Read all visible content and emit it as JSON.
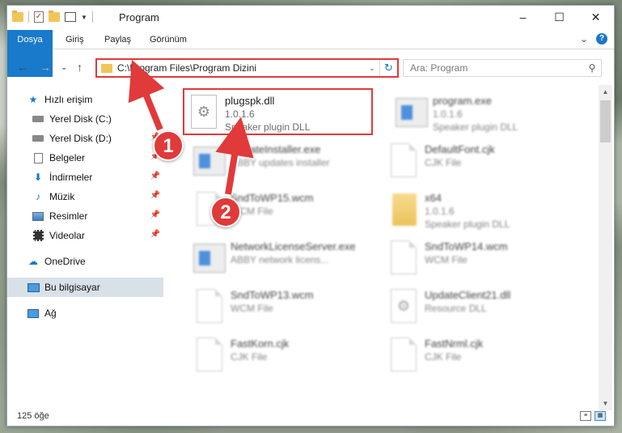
{
  "window": {
    "title": "Program",
    "controls": [
      "–",
      "☐",
      "✕"
    ]
  },
  "ribbon": {
    "tabs": [
      "Dosya",
      "Giriş",
      "Paylaş",
      "Görünüm"
    ],
    "expand": "⌄",
    "help": "?"
  },
  "navigation": {
    "back": "←",
    "forward": "→",
    "recent": "⌄",
    "up": "↑",
    "address": "C:\\Program Files\\Program Dizini",
    "address_dropdown": "⌄",
    "refresh": "↻",
    "search_placeholder": "Ara: Program",
    "search_icon_glyph": "⚲"
  },
  "sidebar": {
    "items": [
      {
        "label": "Hızlı erişim",
        "icon": "star-icon",
        "pinned": false
      },
      {
        "label": "Yerel Disk (C:)",
        "icon": "drive-icon",
        "pinned": true
      },
      {
        "label": "Yerel Disk (D:)",
        "icon": "drive-icon",
        "pinned": true
      },
      {
        "label": "Belgeler",
        "icon": "documents-icon",
        "pinned": true
      },
      {
        "label": "İndirmeler",
        "icon": "download-icon",
        "pinned": true
      },
      {
        "label": "Müzik",
        "icon": "music-icon",
        "pinned": true
      },
      {
        "label": "Resimler",
        "icon": "pictures-icon",
        "pinned": true
      },
      {
        "label": "Videolar",
        "icon": "videos-icon",
        "pinned": true
      },
      {
        "label": "OneDrive",
        "icon": "cloud-icon",
        "pinned": false
      },
      {
        "label": "Bu bilgisayar",
        "icon": "computer-icon",
        "pinned": false
      },
      {
        "label": "Ağ",
        "icon": "network-icon",
        "pinned": false
      }
    ]
  },
  "files": [
    {
      "name": "plugspk.dll",
      "line2": "1.0.1.6",
      "line3": "Speaker plugin DLL",
      "icon": "dll-gear-icon",
      "highlighted": true
    },
    {
      "name": "program.exe",
      "line2": "1.0.1.6",
      "line3": "Speaker plugin DLL",
      "icon": "exe-icon",
      "highlighted": false
    },
    {
      "name": "UpdateInstaller.exe",
      "line2": "ABBY updates installer",
      "line3": "",
      "icon": "exe-icon",
      "highlighted": false
    },
    {
      "name": "DefaultFont.cjk",
      "line2": "CJK File",
      "line3": "",
      "icon": "document-icon",
      "highlighted": false
    },
    {
      "name": "SndToWP15.wcm",
      "line2": "WCM File",
      "line3": "",
      "icon": "document-icon",
      "highlighted": false
    },
    {
      "name": "x64",
      "line2": "1.0.1.6",
      "line3": "Speaker plugin DLL",
      "icon": "folder-icon",
      "highlighted": false
    },
    {
      "name": "NetworkLicenseServer.exe",
      "line2": "ABBY network licens...",
      "line3": "",
      "icon": "exe-icon",
      "highlighted": false
    },
    {
      "name": "SndToWP14.wcm",
      "line2": "WCM File",
      "line3": "",
      "icon": "document-icon",
      "highlighted": false
    },
    {
      "name": "SndToWP13.wcm",
      "line2": "WCM File",
      "line3": "",
      "icon": "document-icon",
      "highlighted": false
    },
    {
      "name": "UpdateClient21.dll",
      "line2": "Resource DLL",
      "line3": "",
      "icon": "dll-gear-icon",
      "highlighted": false
    },
    {
      "name": "FastKorn.cjk",
      "line2": "CJK File",
      "line3": "",
      "icon": "document-icon",
      "highlighted": false
    },
    {
      "name": "FastNrml.cjk",
      "line2": "CJK File",
      "line3": "",
      "icon": "document-icon",
      "highlighted": false
    }
  ],
  "status": {
    "item_count": "125 öğe"
  },
  "annotations": {
    "step1": "1",
    "step2": "2",
    "color": "#e03a3a"
  },
  "colors": {
    "accent": "#1979ca",
    "highlight": "#e03a3a",
    "selected_bg": "#d9e1e8"
  }
}
